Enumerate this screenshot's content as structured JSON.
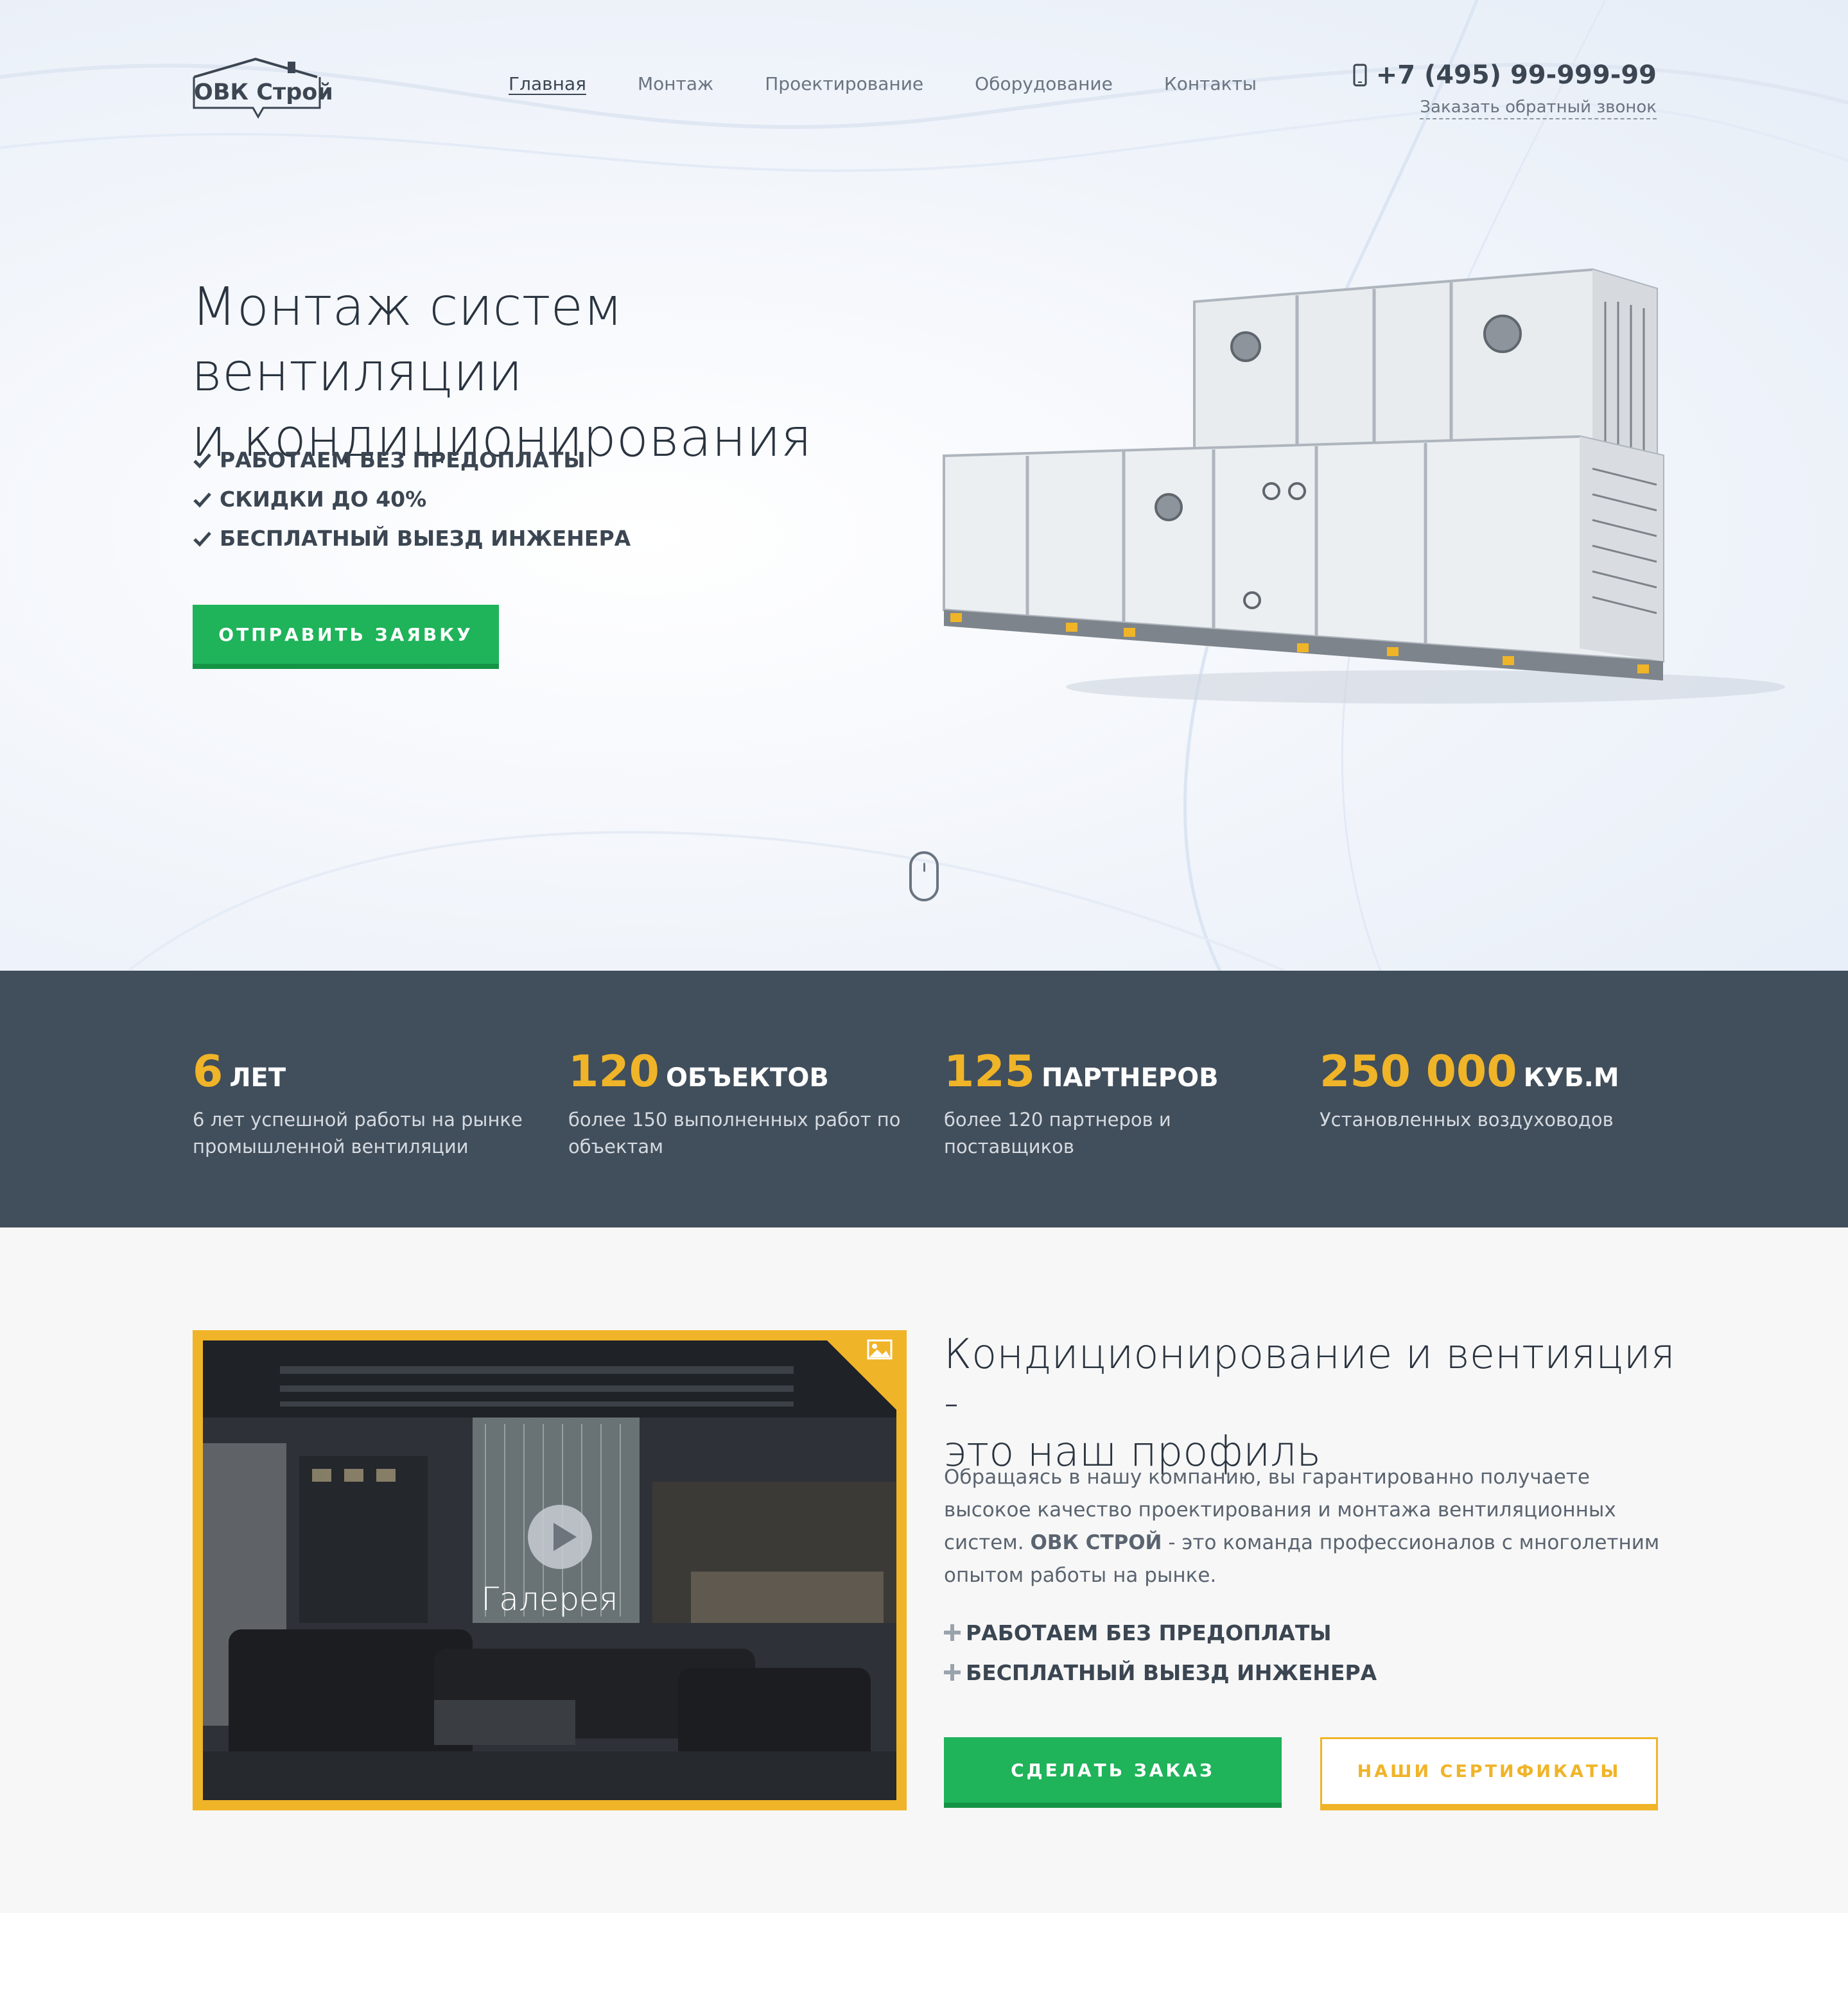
{
  "header": {
    "logo_text": "ОВК Строй",
    "nav": [
      {
        "label": "Главная",
        "active": true
      },
      {
        "label": "Монтаж"
      },
      {
        "label": "Проектирование"
      },
      {
        "label": "Оборудование"
      },
      {
        "label": "Контакты"
      }
    ],
    "phone": "+7 (495) 99-999-99",
    "callback_label": "Заказать обратный звонок"
  },
  "hero": {
    "title_line1": "Монтаж систем вентиляции",
    "title_line2": "и кондиционирования",
    "benefits": [
      "РАБОТАЕМ БЕЗ ПРЕДОПЛАТЫ",
      "СКИДКИ ДО 40%",
      "БЕСПЛАТНЫЙ ВЫЕЗД ИНЖЕНЕРА"
    ],
    "cta_label": "ОТПРАВИТЬ ЗАЯВКУ"
  },
  "stats": [
    {
      "number": "6",
      "unit": "ЛЕТ",
      "desc": "6 лет успешной работы на рынке промышленной вентиляции"
    },
    {
      "number": "120",
      "unit": "ОБЪЕКТОВ",
      "desc": "более 150 выполненных работ по объектам"
    },
    {
      "number": "125",
      "unit": "ПАРТНЕРОВ",
      "desc": "более 120 партнеров и поставщиков"
    },
    {
      "number": "250 000",
      "unit": "КУБ.М",
      "desc": "Установленных воздуховодов"
    }
  ],
  "about": {
    "gallery_label": "Галерея",
    "title_line1": "Кондиционирование и вентияция -",
    "title_line2": "это наш профиль",
    "text_part1": "Обращаясь в нашу компанию, вы гарантированно получаете высокое качество проектирования и монтажа вентиляционных систем. ",
    "text_bold": "ОВК СТРОЙ",
    "text_part2": " - это команда профессионалов с многолетним опытом работы на рынке.",
    "benefits": [
      "РАБОТАЕМ БЕЗ ПРЕДОПЛАТЫ",
      "БЕСПЛАТНЫЙ ВЫЕЗД ИНЖЕНЕРА"
    ],
    "order_label": "СДЕЛАТЬ ЗАКАЗ",
    "cert_label": "НАШИ СЕРТИФИКАТЫ"
  },
  "colors": {
    "accent_green": "#1fb35a",
    "accent_yellow": "#f0b428",
    "stats_bg": "#414e5b"
  }
}
